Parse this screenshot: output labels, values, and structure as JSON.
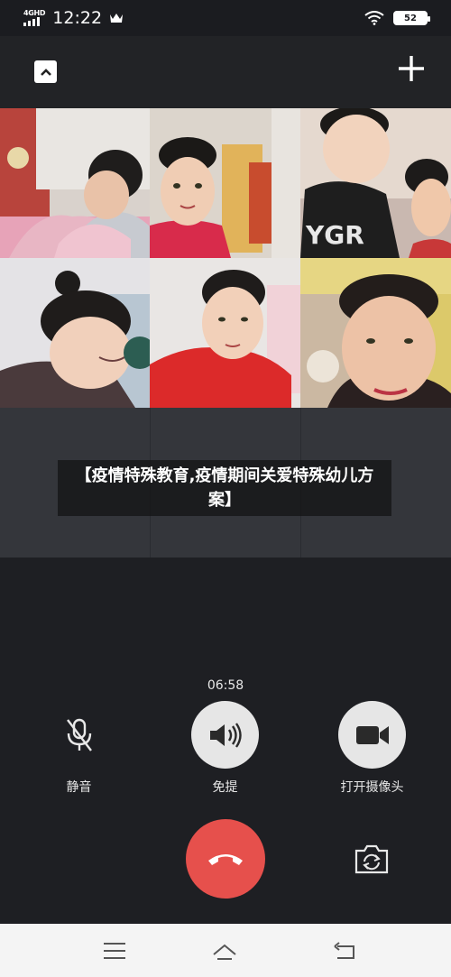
{
  "status_bar": {
    "network": "4GHD",
    "time": "12:22",
    "battery": "52"
  },
  "top_bar": {
    "collapse_icon": "chevron-up-icon",
    "add_icon": "plus-icon"
  },
  "video_tiles": [
    {
      "icon": "participant-video"
    },
    {
      "icon": "participant-video"
    },
    {
      "icon": "participant-video"
    },
    {
      "icon": "participant-video"
    },
    {
      "icon": "participant-video"
    },
    {
      "icon": "participant-video"
    }
  ],
  "caption": "【疫情特殊教育,疫情期间关爱特殊幼儿方案】",
  "call": {
    "timer": "06:58",
    "mute_label": "静音",
    "speaker_label": "免提",
    "camera_label": "打开摄像头"
  },
  "colors": {
    "hangup": "#e6504c",
    "background": "#1e1f23",
    "control_fill": "#e6e6e6"
  }
}
